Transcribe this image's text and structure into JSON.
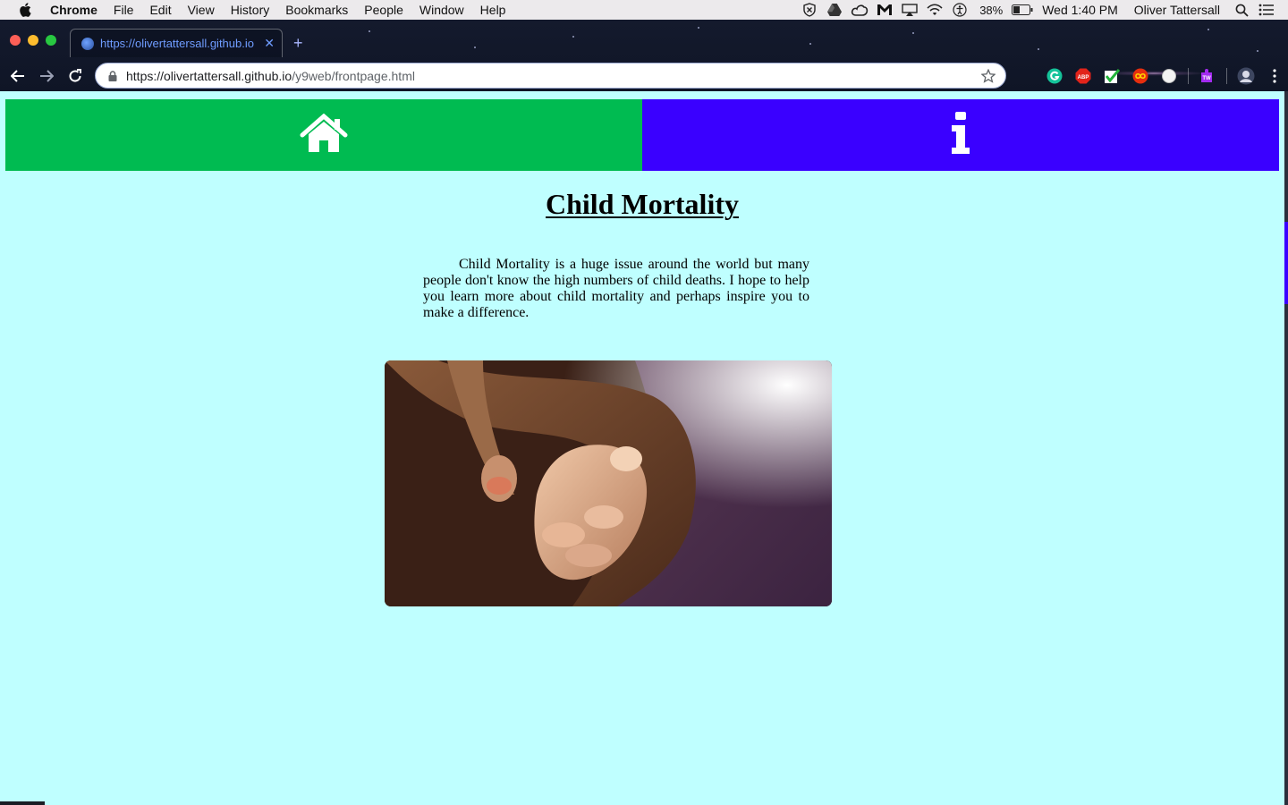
{
  "menubar": {
    "app_name": "Chrome",
    "menus": [
      "File",
      "Edit",
      "View",
      "History",
      "Bookmarks",
      "People",
      "Window",
      "Help"
    ],
    "battery_percent": "38%",
    "clock": "Wed 1:40 PM",
    "user_name": "Oliver Tattersall",
    "status_icons": [
      "malwarebytes-icon",
      "google-drive-icon",
      "creative-cloud-icon",
      "gmail-icon",
      "airplay-icon",
      "wifi-icon",
      "accessibility-icon"
    ]
  },
  "browser": {
    "tab_title": "https://olivertattersall.github.io",
    "url_host": "https://olivertattersall.github.io",
    "url_path": "/y9web/frontpage.html",
    "extensions": [
      "grammarly-icon",
      "adblock-plus-icon",
      "checkmark-extension-icon",
      "infinity-extension-icon",
      "circle-extension-icon",
      "puzzle-extension-icon",
      "profile-avatar-icon"
    ]
  },
  "page": {
    "title": "Child Mortality",
    "intro": "Child Mortality is a huge issue around the world but many people don't know the high numbers of child deaths. I hope to help you learn more about child mortality and perhaps inspire you to make a difference.",
    "nav": {
      "home_icon": "home-icon",
      "info_icon": "info-icon"
    },
    "colors": {
      "background": "#bfffff",
      "home_button": "#00bb51",
      "info_button": "#3a00ff"
    }
  }
}
